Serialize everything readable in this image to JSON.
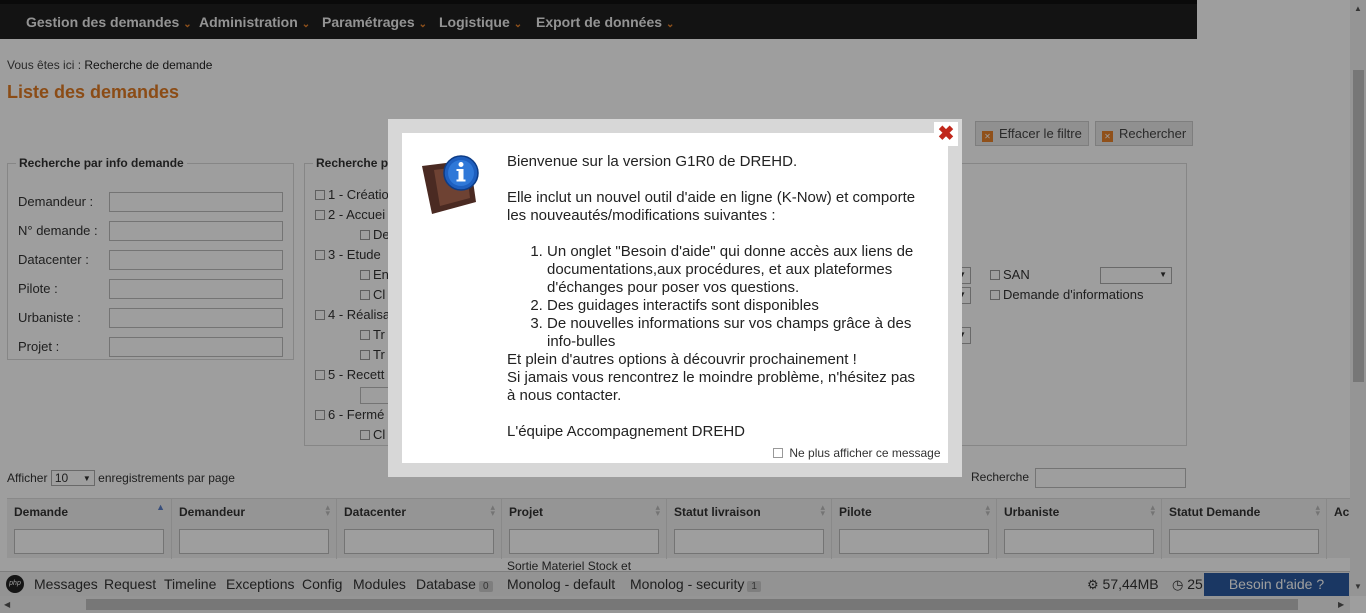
{
  "nav": {
    "items": [
      "Gestion des demandes",
      "Administration",
      "Paramétrages",
      "Logistique",
      "Export de données"
    ]
  },
  "breadcrumb": {
    "prefix": "Vous êtes ici :",
    "current": "Recherche de demande"
  },
  "page_title": "Liste des demandes",
  "toolbar": {
    "clear_filter": "Effacer le filtre",
    "search": "Rechercher"
  },
  "search_info": {
    "legend": "Recherche par info demande",
    "fields": [
      "Demandeur :",
      "N° demande :",
      "Datacenter :",
      "Pilote :",
      "Urbaniste :",
      "Projet :"
    ]
  },
  "search_status": {
    "legend": "Recherche p",
    "rows": [
      "1 - Créatio",
      "2 - Accuei",
      "De",
      "3 - Etude",
      "En",
      "Cl",
      "4 - Réalisa",
      "Tr",
      "Tr",
      "5 - Recett",
      "6 - Fermé",
      "Cl"
    ]
  },
  "extra": {
    "san_label": "SAN",
    "info_request_label": "Demande d'informations"
  },
  "table_controls": {
    "show_prefix": "Afficher",
    "page_size": "10",
    "show_suffix": "enregistrements par page",
    "search_label": "Recherche"
  },
  "table": {
    "columns": [
      "Demande",
      "Demandeur",
      "Datacenter",
      "Projet",
      "Statut livraison",
      "Pilote",
      "Urbaniste",
      "Statut Demande",
      "Ac"
    ],
    "partial_cell": "Sortie Materiel Stock et"
  },
  "debugbar": {
    "logo": "php",
    "tabs": [
      "Messages",
      "Request",
      "Timeline",
      "Exceptions",
      "Config",
      "Modules",
      "Database",
      "Monolog - default",
      "Monolog - security"
    ],
    "database_count": "0",
    "security_count": "1",
    "memory": "57,44MB",
    "time": "25"
  },
  "help_button": "Besoin d'aide ?",
  "modal": {
    "close": "✖",
    "line1": "Bienvenue sur la version G1R0 de DREHD.",
    "line2": "Elle inclut un nouvel outil d'aide en ligne (K-Now) et comporte les nouveautés/modifications suivantes :",
    "items": [
      "Un onglet \"Besoin d'aide\"  qui donne accès aux liens de documentations,aux  procédures, et aux plateformes d'échanges pour poser vos questions.",
      "Des guidages interactifs sont disponibles",
      "De nouvelles informations sur vos champs grâce à des info-bulles"
    ],
    "line3": "Et plein d'autres options à découvrir prochainement !",
    "line4": "Si jamais vous rencontrez le moindre problème, n'hésitez pas à nous contacter.",
    "signature": "L'équipe Accompagnement DREHD",
    "dont_show": "Ne plus afficher ce message"
  },
  "colors": {
    "accent": "#e07b24",
    "nav_bg": "#1f1f1f",
    "help_bg": "#2a5aa0",
    "close": "#c0271b"
  }
}
